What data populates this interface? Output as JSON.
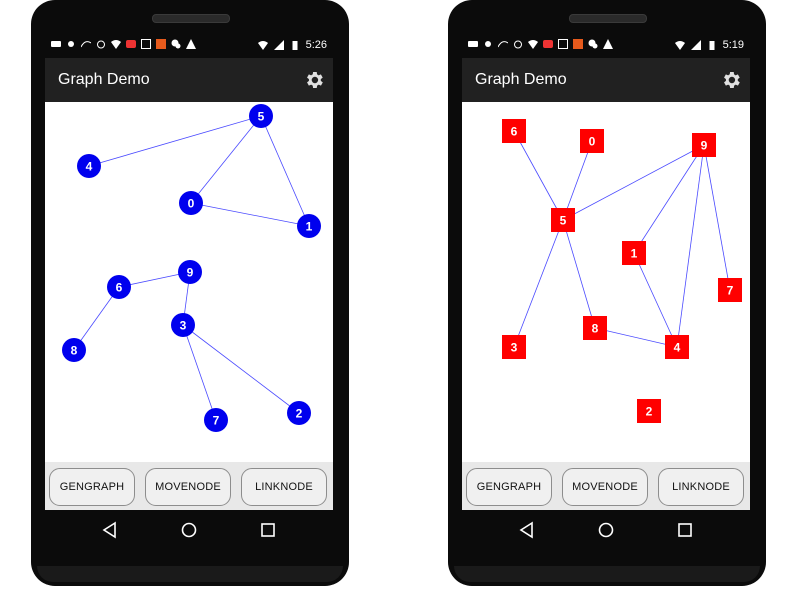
{
  "phones": [
    {
      "status_time": "5:26",
      "app_title": "Graph Demo",
      "buttons": [
        "GENGRAPH",
        "MOVENODE",
        "LINKNODE"
      ],
      "node_shape": "circle",
      "node_color": "#0000ee",
      "edge_color": "#4a4aff",
      "nodes": [
        "5",
        "4",
        "0",
        "1",
        "9",
        "6",
        "3",
        "8",
        "7",
        "2"
      ],
      "edges": [
        [
          "5",
          "4"
        ],
        [
          "5",
          "0"
        ],
        [
          "5",
          "1"
        ],
        [
          "0",
          "1"
        ],
        [
          "9",
          "6"
        ],
        [
          "9",
          "3"
        ],
        [
          "6",
          "8"
        ],
        [
          "3",
          "7"
        ],
        [
          "3",
          "2"
        ]
      ]
    },
    {
      "status_time": "5:19",
      "app_title": "Graph Demo",
      "buttons": [
        "GENGRAPH",
        "MOVENODE",
        "LINKNODE"
      ],
      "node_shape": "square",
      "node_color": "#ff0000",
      "edge_color": "#4a4aff",
      "nodes": [
        "6",
        "0",
        "9",
        "5",
        "1",
        "7",
        "3",
        "8",
        "4",
        "2"
      ],
      "edges": [
        [
          "6",
          "5"
        ],
        [
          "0",
          "5"
        ],
        [
          "9",
          "5"
        ],
        [
          "9",
          "1"
        ],
        [
          "9",
          "4"
        ],
        [
          "9",
          "7"
        ],
        [
          "5",
          "3"
        ],
        [
          "5",
          "8"
        ],
        [
          "8",
          "4"
        ],
        [
          "1",
          "4"
        ]
      ]
    }
  ],
  "icons": {
    "settings": "gear-icon",
    "nav": [
      "back-icon",
      "home-icon",
      "recents-icon"
    ],
    "status": [
      "message-icon",
      "brightness-icon",
      "signature-icon",
      "alarm-icon",
      "wifi-question-icon",
      "badge-icon",
      "save-icon",
      "a-icon",
      "wechat-icon",
      "warning-icon"
    ]
  }
}
